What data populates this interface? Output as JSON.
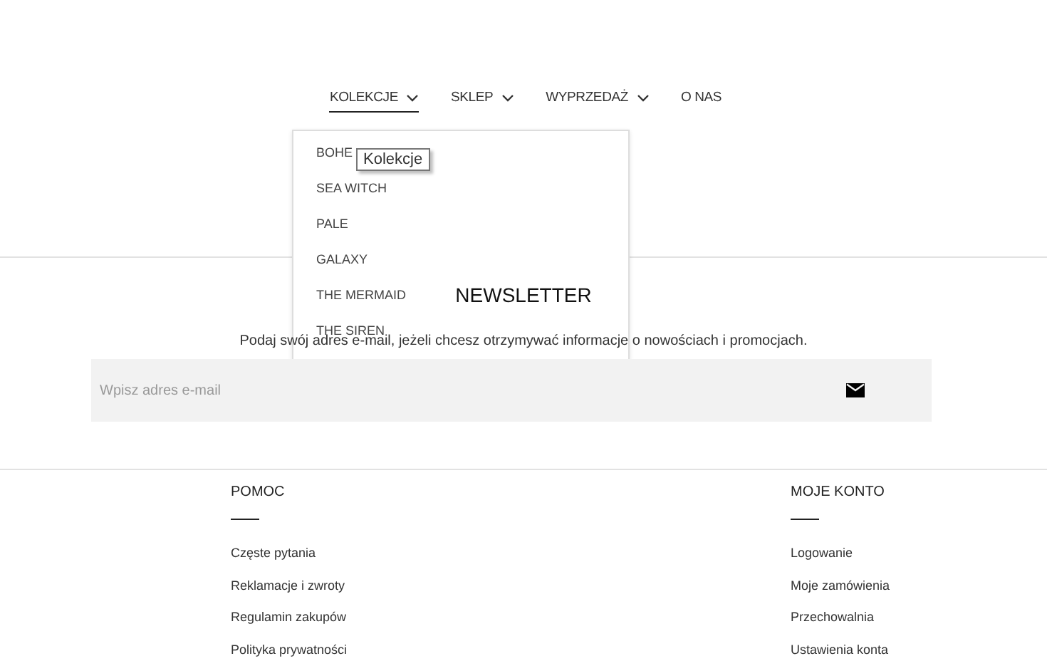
{
  "nav": [
    {
      "label": "KOLEKCJE",
      "selected": true,
      "has_menu": true
    },
    {
      "label": "SKLEP",
      "selected": false,
      "has_menu": true
    },
    {
      "label": "WYPRZEDAŻ",
      "selected": false,
      "has_menu": true
    },
    {
      "label": "O NAS",
      "selected": false,
      "has_menu": false
    }
  ],
  "dropdown": {
    "items": [
      "BOHE",
      "SEA WITCH",
      "PALE",
      "GALAXY",
      "THE MERMAID",
      "THE SIREN"
    ],
    "tooltip": "Kolekcje"
  },
  "newsletter": {
    "title": "NEWSLETTER",
    "text": "Podaj swój adres e-mail, jeżeli chcesz otrzymywać informacje o nowościach i promocjach.",
    "placeholder": "Wpisz adres e-mail"
  },
  "footer": [
    {
      "title": "POMOC",
      "links": [
        "Częste pytania",
        "Reklamacje i zwroty",
        "Regulamin zakupów",
        "Polityka prywatności"
      ]
    },
    {
      "title": "MOJE KONTO",
      "links": [
        "Logowanie",
        "Moje zamówienia",
        "Przechowalnia",
        "Ustawienia konta"
      ]
    }
  ]
}
